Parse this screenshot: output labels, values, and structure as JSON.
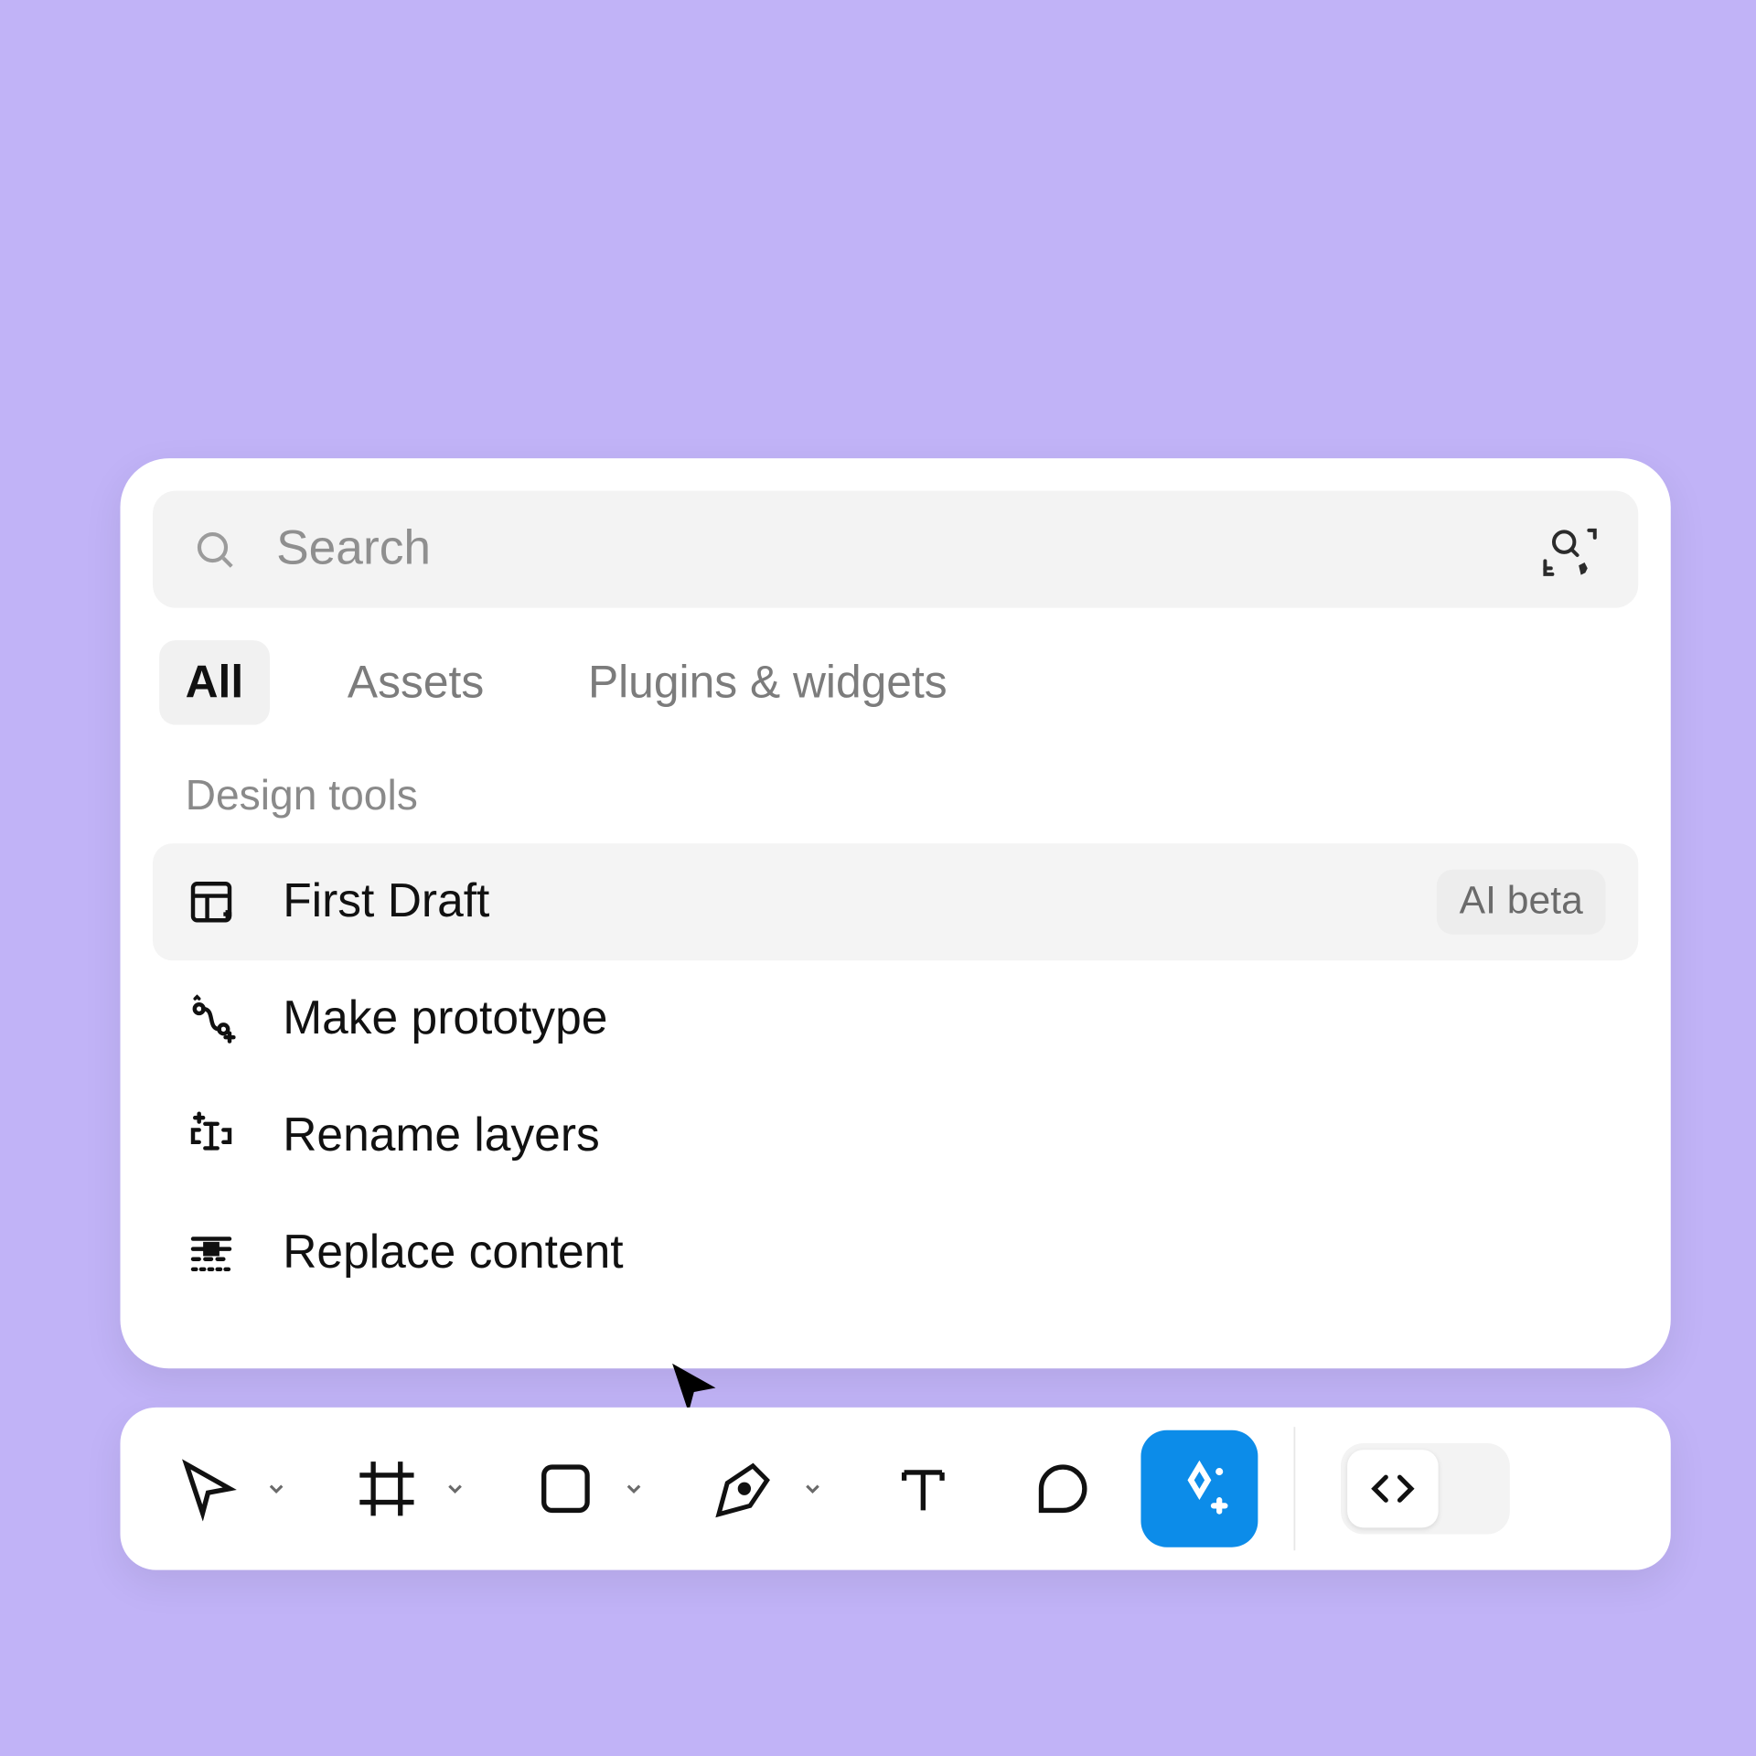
{
  "search": {
    "placeholder": "Search",
    "value": ""
  },
  "tabs": [
    {
      "label": "All",
      "active": true
    },
    {
      "label": "Assets",
      "active": false
    },
    {
      "label": "Plugins & widgets",
      "active": false
    }
  ],
  "section_title": "Design tools",
  "tools": [
    {
      "label": "First Draft",
      "badge": "AI beta",
      "hover": true,
      "icon": "first-draft"
    },
    {
      "label": "Make prototype",
      "icon": "make-prototype"
    },
    {
      "label": "Rename layers",
      "icon": "rename-layers"
    },
    {
      "label": "Replace content",
      "icon": "replace-content"
    }
  ],
  "toolbar": {
    "move": "Move",
    "frame": "Frame",
    "rect": "Rectangle",
    "pen": "Pen",
    "text": "Text",
    "comment": "Comment",
    "actions": "Actions",
    "devmode": "Dev Mode"
  }
}
